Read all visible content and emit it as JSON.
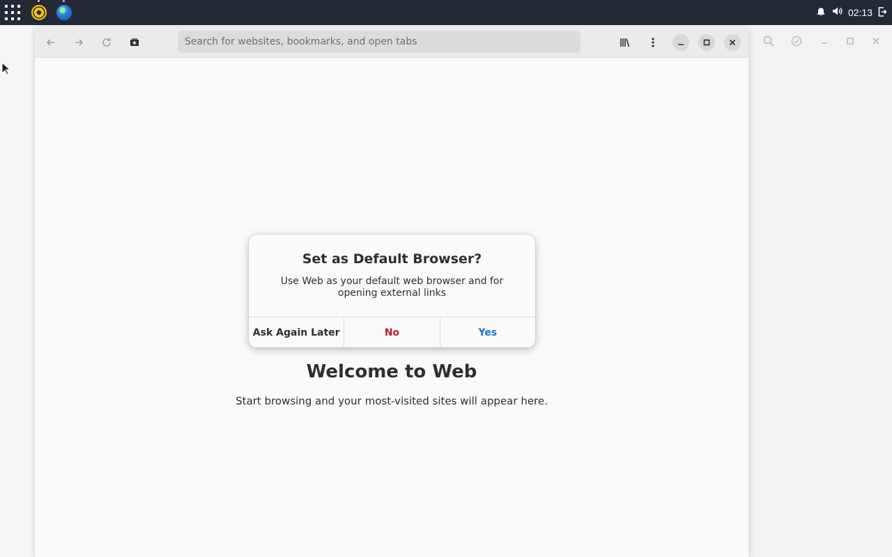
{
  "panel": {
    "clock": "02:13",
    "icons": [
      "apps-grid-icon",
      "rhythmbox-icon",
      "web-browser-icon",
      "bell-icon",
      "volume-icon",
      "logout-icon"
    ]
  },
  "browser": {
    "search": {
      "placeholder": "Search for websites, bookmarks, and open tabs",
      "value": ""
    },
    "toolbar_icons": [
      "back-arrow-icon",
      "forward-arrow-icon",
      "reload-icon",
      "new-tab-icon",
      "bookmarks-library-icon",
      "menu-kebab-icon",
      "minimize-icon",
      "maximize-icon",
      "close-icon"
    ]
  },
  "page": {
    "welcome_title": "Welcome to Web",
    "welcome_subtitle": "Start browsing and your most-visited sites will appear here."
  },
  "dialog": {
    "title": "Set as Default Browser?",
    "body": "Use Web as your default web browser and for opening external links",
    "buttons": {
      "later": "Ask Again Later",
      "no": "No",
      "yes": "Yes"
    }
  },
  "colors": {
    "panel": "#242a35",
    "no_button": "#c01c28",
    "yes_button": "#1c71d8"
  }
}
